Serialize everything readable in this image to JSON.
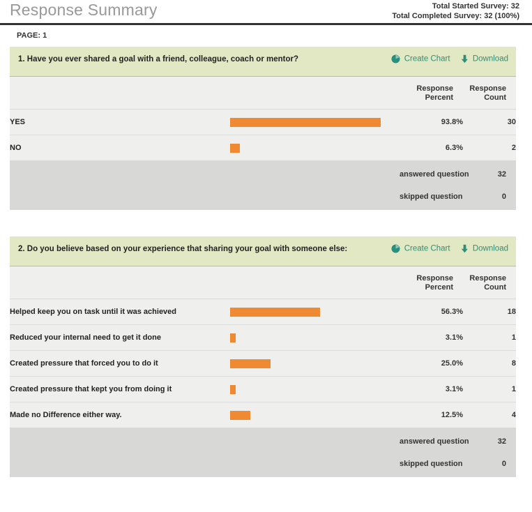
{
  "header": {
    "title": "Response Summary",
    "total_started_label": "Total Started Survey:",
    "total_started_value": "32",
    "total_completed_label": "Total Completed Survey:",
    "total_completed_value": "32  (100%)"
  },
  "page_nav": {
    "page_word": "PAGE:",
    "page_number": "1"
  },
  "table_headers": {
    "response_percent_line1": "Response",
    "response_percent_line2": "Percent",
    "response_count_line1": "Response",
    "response_count_line2": "Count"
  },
  "actions": {
    "create_chart": "Create Chart",
    "download": "Download",
    "create_chart_icon": "pie-chart-icon",
    "download_icon": "download-arrow-icon"
  },
  "footer_labels": {
    "answered": "answered question",
    "skipped": "skipped question"
  },
  "colors": {
    "bar": "#ef8a33",
    "question_header": "#e3e8c4",
    "action_link": "#2a8f7d",
    "row_background": "#efefee",
    "footer_background": "#d8d8d6",
    "title_gray": "#999999"
  },
  "questions": [
    {
      "number": "1.",
      "text": "1. Have you ever shared a goal with a friend, colleague, coach or mentor?",
      "rows": [
        {
          "label": "YES",
          "percent": "93.8%",
          "percent_value": 93.8,
          "count": "30"
        },
        {
          "label": "NO",
          "percent": "6.3%",
          "percent_value": 6.3,
          "count": "2"
        }
      ],
      "answered": "32",
      "skipped": "0"
    },
    {
      "number": "2.",
      "text": "2. Do you believe based on your experience that sharing your goal with someone else:",
      "rows": [
        {
          "label": "Helped keep you on task until it was achieved",
          "percent": "56.3%",
          "percent_value": 56.3,
          "count": "18"
        },
        {
          "label": "Reduced your internal need to get it done",
          "percent": "3.1%",
          "percent_value": 3.1,
          "count": "1"
        },
        {
          "label": "Created pressure that forced you to do it",
          "percent": "25.0%",
          "percent_value": 25.0,
          "count": "8"
        },
        {
          "label": "Created pressure that kept you from doing it",
          "percent": "3.1%",
          "percent_value": 3.1,
          "count": "1"
        },
        {
          "label": "Made no Difference either way.",
          "percent": "12.5%",
          "percent_value": 12.5,
          "count": "4"
        }
      ],
      "answered": "32",
      "skipped": "0"
    }
  ],
  "chart_data": {
    "type": "bar",
    "title": "Response Summary",
    "charts": [
      {
        "title": "1. Have you ever shared a goal with a friend, colleague, coach or mentor?",
        "categories": [
          "YES",
          "NO"
        ],
        "values": [
          93.8,
          6.3
        ],
        "counts": [
          30,
          2
        ],
        "ylabel": "Response Percent",
        "xlim": [
          0,
          100
        ],
        "answered": 32,
        "skipped": 0
      },
      {
        "title": "2. Do you believe based on your experience that sharing your goal with someone else:",
        "categories": [
          "Helped keep you on task until it was achieved",
          "Reduced your internal need to get it done",
          "Created pressure that forced you to do it",
          "Created pressure that kept you from doing it",
          "Made no Difference either way."
        ],
        "values": [
          56.3,
          3.1,
          25.0,
          3.1,
          12.5
        ],
        "counts": [
          18,
          1,
          8,
          1,
          4
        ],
        "ylabel": "Response Percent",
        "xlim": [
          0,
          100
        ],
        "answered": 32,
        "skipped": 0
      }
    ]
  }
}
